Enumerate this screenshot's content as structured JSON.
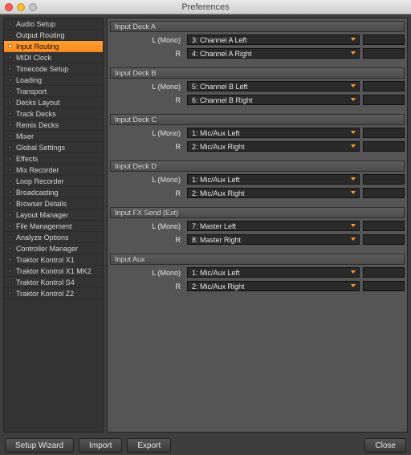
{
  "window": {
    "title": "Preferences"
  },
  "sidebar": {
    "items": [
      {
        "label": "Audio Setup"
      },
      {
        "label": "Output Routing"
      },
      {
        "label": "Input Routing"
      },
      {
        "label": "MIDI Clock"
      },
      {
        "label": "Timecode Setup"
      },
      {
        "label": "Loading"
      },
      {
        "label": "Transport"
      },
      {
        "label": "Decks Layout"
      },
      {
        "label": "Track Decks"
      },
      {
        "label": "Remix Decks"
      },
      {
        "label": "Mixer"
      },
      {
        "label": "Global Settings"
      },
      {
        "label": "Effects"
      },
      {
        "label": "Mix Recorder"
      },
      {
        "label": "Loop Recorder"
      },
      {
        "label": "Broadcasting"
      },
      {
        "label": "Browser Details"
      },
      {
        "label": "Layout Manager"
      },
      {
        "label": "File Management"
      },
      {
        "label": "Analyze Options"
      },
      {
        "label": "Controller Manager"
      },
      {
        "label": "Traktor Kontrol X1"
      },
      {
        "label": "Traktor Kontrol X1 MK2"
      },
      {
        "label": "Traktor Kontrol S4"
      },
      {
        "label": "Traktor Kontrol Z2"
      }
    ],
    "active_index": 2
  },
  "labels": {
    "l_mono": "L (Mono)",
    "r": "R"
  },
  "sections": [
    {
      "title": "Input Deck A",
      "left": "3: Channel A Left",
      "right": "4: Channel A Right"
    },
    {
      "title": "Input Deck B",
      "left": "5: Channel B Left",
      "right": "6: Channel B Right"
    },
    {
      "title": "Input Deck C",
      "left": "1: Mic/Aux Left",
      "right": "2: Mic/Aux Right"
    },
    {
      "title": "Input Deck D",
      "left": "1: Mic/Aux Left",
      "right": "2: Mic/Aux Right"
    },
    {
      "title": "Input FX Send (Ext)",
      "left": "7: Master Left",
      "right": "8: Master Right"
    },
    {
      "title": "Input Aux",
      "left": "1: Mic/Aux Left",
      "right": "2: Mic/Aux Right"
    }
  ],
  "footer": {
    "setup_wizard": "Setup Wizard",
    "import": "Import",
    "export": "Export",
    "close": "Close"
  },
  "colors": {
    "accent": "#ff8a1f"
  }
}
